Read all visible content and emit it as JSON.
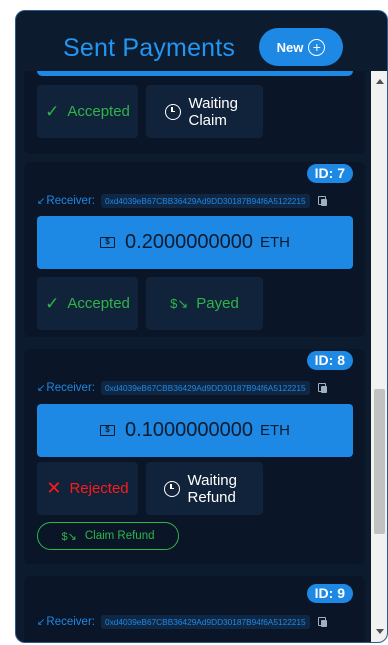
{
  "header": {
    "title": "Sent Payments",
    "new_label": "New",
    "new_icon": "plus-circle-icon"
  },
  "colors": {
    "accent": "#1e88e5",
    "panel": "#0d1b2e",
    "success": "#2db54a",
    "danger": "#ff1a1a"
  },
  "payments": [
    {
      "status": "Accepted",
      "claim_state": "Waiting Claim"
    },
    {
      "id": "ID: 7",
      "receiver_label": "Receiver:",
      "address": "0xd4039eB67CBB36429Ad9DD30187B94f6A5122215",
      "amount": "0.2000000000",
      "unit": "ETH",
      "status": "Accepted",
      "claim_state": "Payed"
    },
    {
      "id": "ID: 8",
      "receiver_label": "Receiver:",
      "address": "0xd4039eB67CBB36429Ad9DD30187B94f6A5122215",
      "amount": "0.1000000000",
      "unit": "ETH",
      "status": "Rejected",
      "claim_state": "Waiting Refund",
      "action": "Claim Refund"
    },
    {
      "id": "ID: 9",
      "receiver_label": "Receiver:",
      "address": "0xd4039eB67CBB36429Ad9DD30187B94f6A5122215"
    }
  ]
}
